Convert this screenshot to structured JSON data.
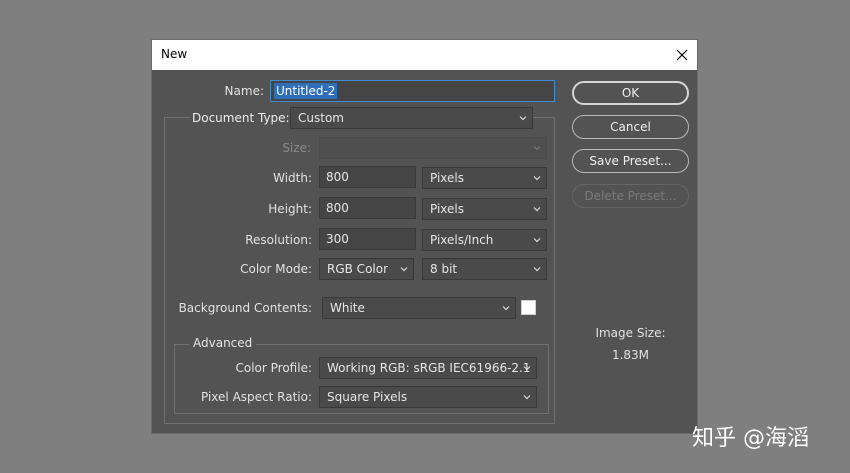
{
  "dialog": {
    "title": "New",
    "name_label": "Name:",
    "name_value": "Untitled-2",
    "document_type_label": "Document Type:",
    "document_type_value": "Custom",
    "size_label": "Size:",
    "size_value": "",
    "width_label": "Width:",
    "width_value": "800",
    "width_unit": "Pixels",
    "height_label": "Height:",
    "height_value": "800",
    "height_unit": "Pixels",
    "resolution_label": "Resolution:",
    "resolution_value": "300",
    "resolution_unit": "Pixels/Inch",
    "color_mode_label": "Color Mode:",
    "color_mode_value": "RGB Color",
    "bit_depth_value": "8 bit",
    "background_label": "Background Contents:",
    "background_value": "White",
    "background_swatch_color": "#ffffff",
    "advanced_label": "Advanced",
    "color_profile_label": "Color Profile:",
    "color_profile_value": "Working RGB:  sRGB IEC61966-2.1",
    "pixel_aspect_label": "Pixel Aspect Ratio:",
    "pixel_aspect_value": "Square Pixels"
  },
  "buttons": {
    "ok": "OK",
    "cancel": "Cancel",
    "save_preset": "Save Preset...",
    "delete_preset": "Delete Preset..."
  },
  "image_size": {
    "label": "Image Size:",
    "value": "1.83M"
  },
  "watermark": "知乎 @海滔",
  "colors": {
    "desktop": "#7f7f7f",
    "dialog_bg": "#535353",
    "selection": "#2f6fb9"
  }
}
